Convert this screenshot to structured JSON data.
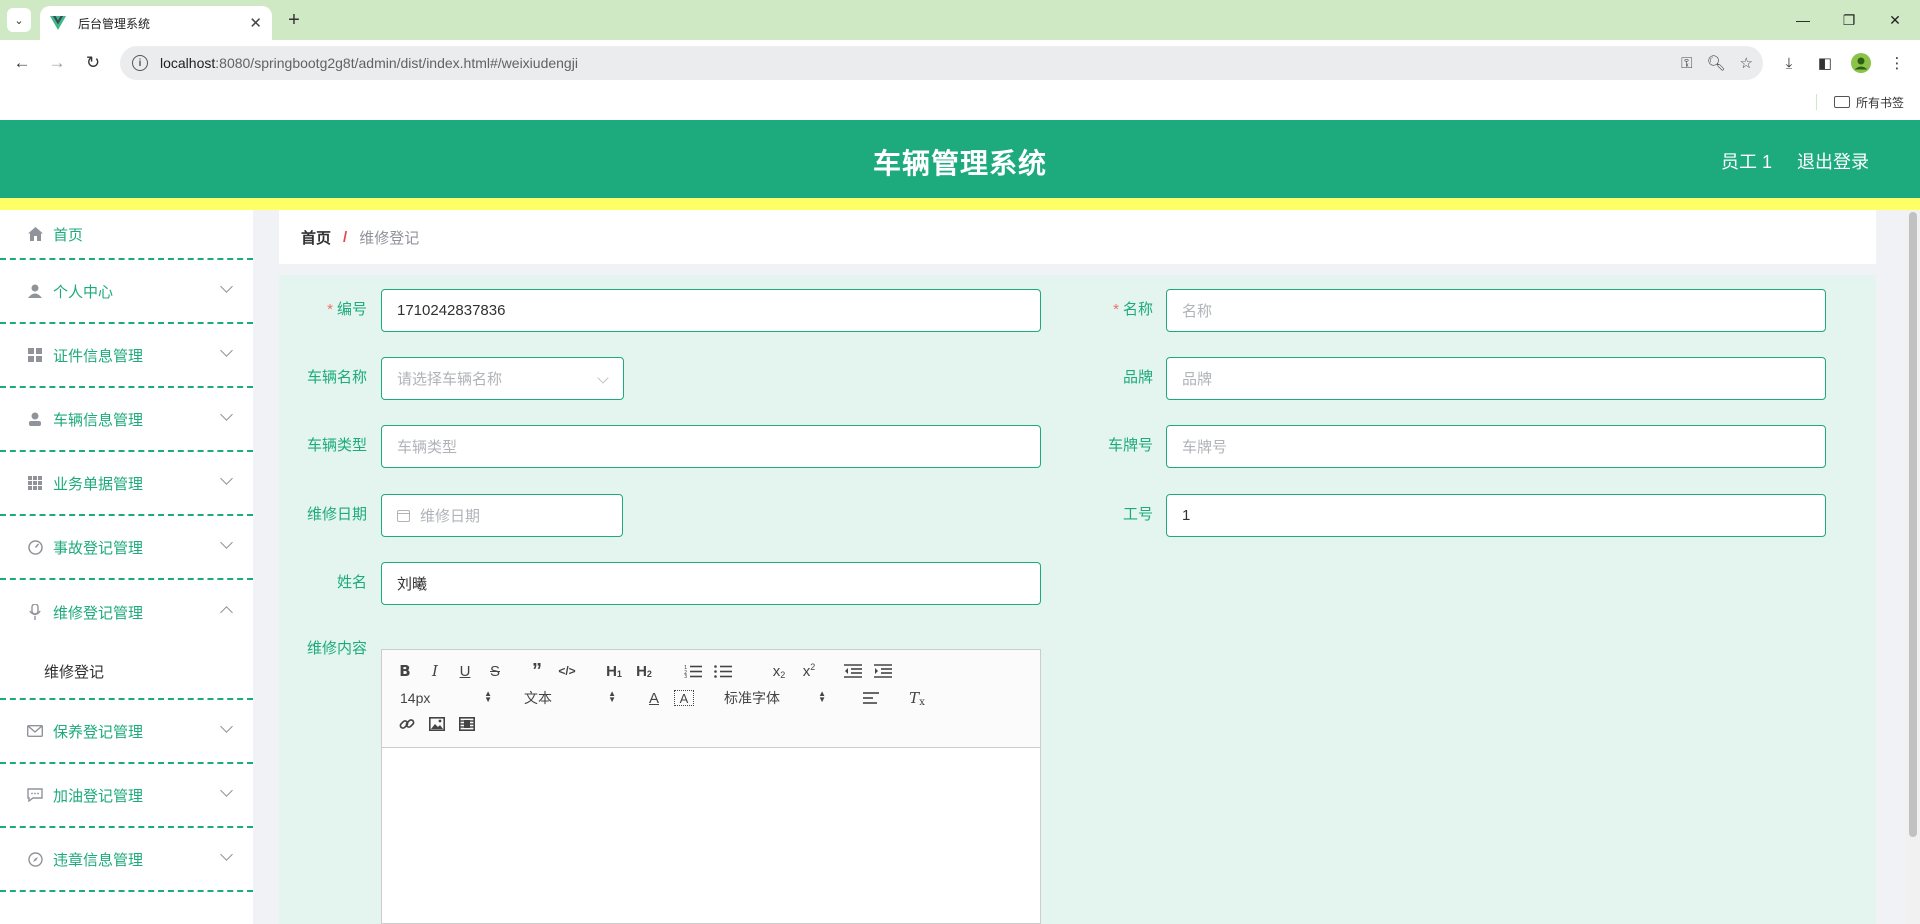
{
  "browser": {
    "tab_title": "后台管理系统",
    "url_host": "localhost",
    "url_rest": ":8080/springbootg2g8t/admin/dist/index.html#/weixiudengji",
    "bookmarks_label": "所有书签"
  },
  "header": {
    "title": "车辆管理系统",
    "user": "员工 1",
    "logout": "退出登录"
  },
  "sidebar": {
    "items": [
      {
        "label": "首页",
        "icon": "home-icon"
      },
      {
        "label": "个人中心",
        "icon": "user-icon"
      },
      {
        "label": "证件信息管理",
        "icon": "grid-icon"
      },
      {
        "label": "车辆信息管理",
        "icon": "person-icon"
      },
      {
        "label": "业务单据管理",
        "icon": "apps-icon"
      },
      {
        "label": "事故登记管理",
        "icon": "gauge-icon"
      },
      {
        "label": "维修登记管理",
        "icon": "mic-icon"
      },
      {
        "label": "保养登记管理",
        "icon": "mail-icon"
      },
      {
        "label": "加油登记管理",
        "icon": "chat-icon"
      },
      {
        "label": "违章信息管理",
        "icon": "compass-icon"
      }
    ],
    "sub_item": "维修登记"
  },
  "breadcrumb": {
    "home": "首页",
    "separator": "/",
    "current": "维修登记"
  },
  "form": {
    "bianhao": {
      "label": "编号",
      "value": "1710242837836"
    },
    "mingcheng": {
      "label": "名称",
      "placeholder": "名称"
    },
    "cheliangmingcheng": {
      "label": "车辆名称",
      "placeholder": "请选择车辆名称"
    },
    "pinpai": {
      "label": "品牌",
      "placeholder": "品牌"
    },
    "cheliangleixing": {
      "label": "车辆类型",
      "placeholder": "车辆类型"
    },
    "chepaihao": {
      "label": "车牌号",
      "placeholder": "车牌号"
    },
    "weixiuriqi": {
      "label": "维修日期",
      "placeholder": "维修日期"
    },
    "gonghao": {
      "label": "工号",
      "value": "1"
    },
    "xingming": {
      "label": "姓名",
      "value": "刘曦"
    },
    "weixiuneirong": {
      "label": "维修内容"
    },
    "required_mark": "*"
  },
  "editor": {
    "font_size": "14px",
    "header_picker": "文本",
    "font_family": "标准字体"
  },
  "colors": {
    "primary": "#1daa7c",
    "header_bg": "#1daa7c",
    "accent_strip": "#ffff66",
    "panel_bg": "#e3f5ee",
    "required": "#f56c6c"
  }
}
